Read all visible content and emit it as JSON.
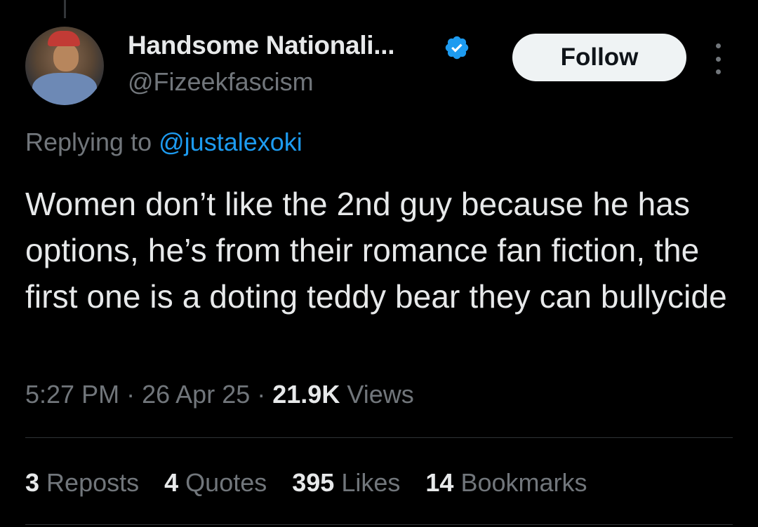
{
  "author": {
    "display_name": "Handsome Nationali...",
    "handle": "@Fizeekfascism",
    "verified": true,
    "verified_color": "#1d9bf0"
  },
  "actions": {
    "follow_label": "Follow",
    "more_icon": "more-vertical-icon"
  },
  "reply": {
    "prefix": "Replying to",
    "mention": "@justalexoki"
  },
  "tweet": {
    "text": "Women don’t like the 2nd guy because he has options, he’s from their romance fan fiction, the first one is a doting teddy bear they can bullycide"
  },
  "meta": {
    "time": "5:27 PM",
    "date": "26 Apr 25",
    "views_count": "21.9K",
    "views_label": "Views",
    "separator": "·"
  },
  "stats": [
    {
      "count": "3",
      "label": "Reposts"
    },
    {
      "count": "4",
      "label": "Quotes"
    },
    {
      "count": "395",
      "label": "Likes"
    },
    {
      "count": "14",
      "label": "Bookmarks"
    }
  ],
  "colors": {
    "background": "#000000",
    "text_primary": "#e7e9ea",
    "text_secondary": "#71767b",
    "link": "#1d9bf0",
    "follow_bg": "#eff3f4"
  }
}
